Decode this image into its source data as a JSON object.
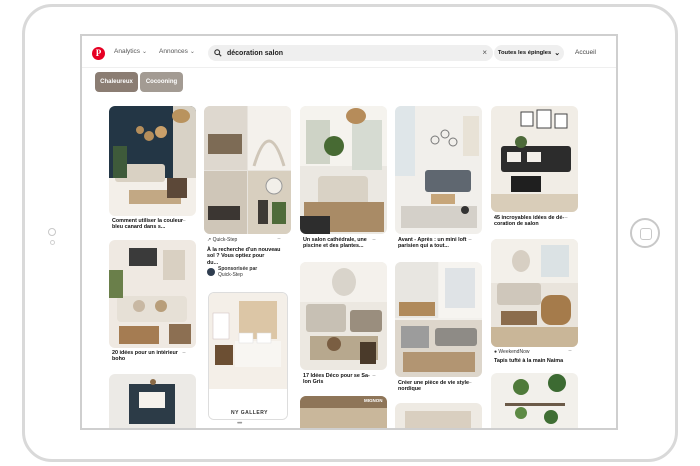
{
  "topbar": {
    "nav_analytics": "Analytics",
    "nav_annonces": "Annonces",
    "search_value": "décoration salon",
    "scope_label": "Toutes les épingles",
    "home_label": "Accueil"
  },
  "chips": [
    {
      "label": "Chaleureux",
      "color": "#8b7d73"
    },
    {
      "label": "Cocooning",
      "color": "#a39b93"
    }
  ],
  "pins": {
    "p1_caption_l1": "Comment utiliser la couleur",
    "p1_caption_l2": "bleu canard dans s...",
    "p2_source": "Quick-Step",
    "p2_caption_l1": "À la recherche d'un nouveau",
    "p2_caption_l2": "sol ? Vous optiez pour",
    "p2_caption_l3": "du...",
    "p2_promo": "Sponsorisée par",
    "p2_promo_by": "Quick-Step",
    "p3_caption_l1": "Un salon cathédrale, une",
    "p3_caption_l2": "piscine et des plantes...",
    "p4_caption_l1": "Avant - Après : un mini loft",
    "p4_caption_l2": "parisien qui a tout...",
    "p5_caption_l1": "45 incroyables idées de dé-",
    "p5_caption_l2": "coration de salon",
    "p6_caption_l1": "20 idées pour un intérieur",
    "p6_caption_l2": "boho",
    "p7_overlay": "NY GALLERY",
    "p8_caption_l1": "17 Idées Déco pour se Sa-",
    "p8_caption_l2": "lon Gris",
    "p9_caption_l1": "Créer une pièce de vie style",
    "p9_caption_l2": "nordique",
    "p10_source": "WeekendNow",
    "p10_caption": "Tapis tufté à la main Naima",
    "p11_badge": "MIGNON"
  },
  "colors": {
    "brand": "#e60023",
    "search_bg": "#efefef"
  }
}
